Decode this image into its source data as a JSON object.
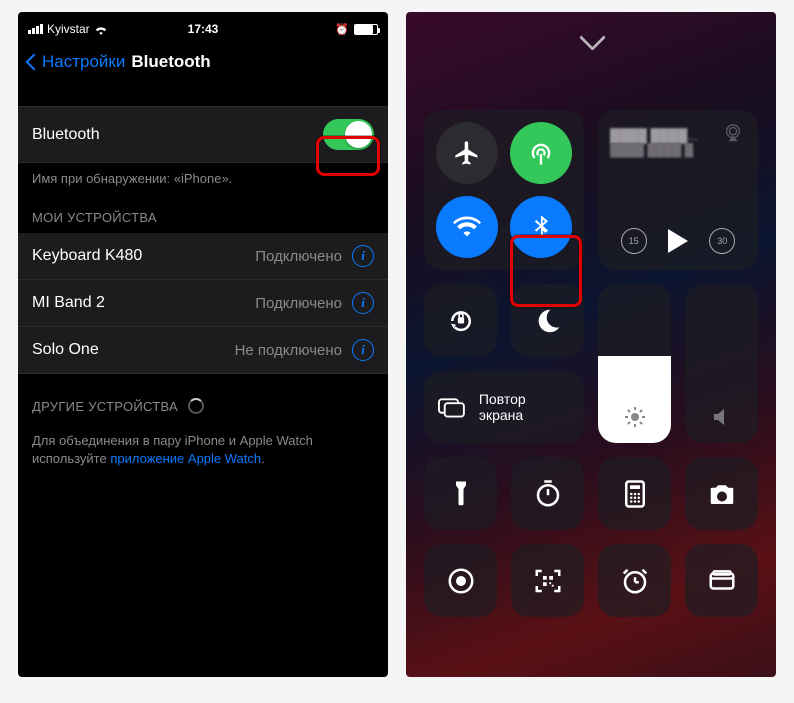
{
  "statusbar": {
    "carrier": "Kyivstar",
    "time": "17:43"
  },
  "nav": {
    "back": "Настройки",
    "title": "Bluetooth"
  },
  "bt_row": {
    "label": "Bluetooth"
  },
  "discover_caption": "Имя при обнаружении: «iPhone».",
  "my_devices_header": "МОИ УСТРОЙСТВА",
  "devices": [
    {
      "name": "Keyboard K480",
      "status": "Подключено"
    },
    {
      "name": "MI Band 2",
      "status": "Подключено"
    },
    {
      "name": "Solo One",
      "status": "Не подключено"
    }
  ],
  "other_devices_header": "ДРУГИЕ УСТРОЙСТВА",
  "footer": {
    "t1": "Для объединения в пару iPhone и Apple Watch используйте ",
    "link": "приложение Apple Watch",
    "t2": "."
  },
  "cc": {
    "media": {
      "back15": "15",
      "fwd30": "30"
    },
    "mirror_label": "Повтор экрана"
  }
}
